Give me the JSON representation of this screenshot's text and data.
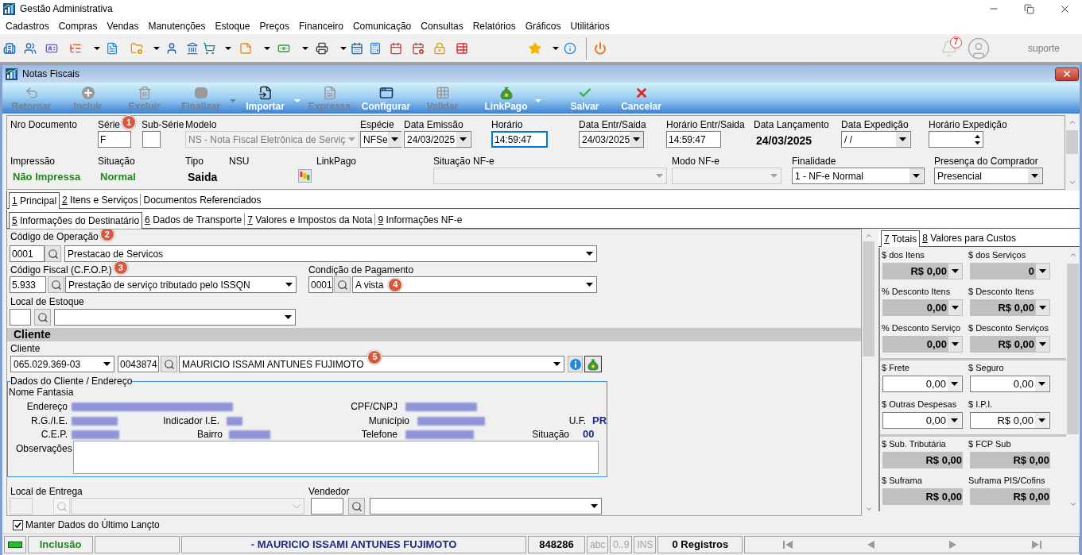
{
  "window": {
    "title": "Gestão Administrativa"
  },
  "menu": [
    "Cadastros",
    "Compras",
    "Vendas",
    "Manutenções",
    "Estoque",
    "Preços",
    "Financeiro",
    "Comunicação",
    "Consultas",
    "Relatórios",
    "Gráficos",
    "Utilitários"
  ],
  "toolbar": {
    "notification_count": "7",
    "user": "suporte"
  },
  "document_window": {
    "title": "Notas Fiscais"
  },
  "actions": [
    {
      "label": "Retornar",
      "disabled": true,
      "has_menu": false
    },
    {
      "label": "Incluir",
      "disabled": true,
      "has_menu": false
    },
    {
      "label": "Excluir",
      "disabled": true,
      "has_menu": false
    },
    {
      "label": "Finalizar",
      "disabled": true,
      "has_menu": true
    },
    {
      "label": "Importar",
      "disabled": false,
      "has_menu": true
    },
    {
      "label": "Expressa",
      "disabled": true,
      "has_menu": false
    },
    {
      "label": "Configurar",
      "disabled": false,
      "has_menu": false
    },
    {
      "label": "Validar",
      "disabled": true,
      "has_menu": false
    },
    {
      "label": "LinkPago",
      "disabled": false,
      "has_menu": true
    },
    {
      "label": "Salvar",
      "disabled": false,
      "has_menu": false
    },
    {
      "label": "Cancelar",
      "disabled": false,
      "has_menu": false
    }
  ],
  "header": {
    "fields": [
      {
        "label": "Nro Documento",
        "kind": "empty"
      },
      {
        "label": "Série",
        "kind": "input",
        "value": "F",
        "focused": false,
        "badge": "1"
      },
      {
        "label": "Sub-Série",
        "kind": "input",
        "focused": false
      },
      {
        "label": "Modelo",
        "kind": "select",
        "value": "NS - Nota Fiscal Eletrônica de Serviç",
        "disabled": true
      },
      {
        "label": "Espécie",
        "kind": "select",
        "value": "NFSe",
        "disabled": false
      },
      {
        "label": "Data Emissão",
        "kind": "select",
        "value": "24/03/2025",
        "disabled": false
      },
      {
        "label": "Horário",
        "kind": "input",
        "value": "14:59:47",
        "focused": true
      },
      {
        "label": "Data Entr/Saida",
        "kind": "select",
        "value": "24/03/2025",
        "disabled": false
      },
      {
        "label": "Horário Entr/Saida",
        "kind": "input",
        "value": "14:59:47",
        "focused": false
      },
      {
        "label": "Data Lançamento",
        "kind": "static",
        "value": "24/03/2025"
      },
      {
        "label": "Data Expedição",
        "kind": "select",
        "value": "/ /",
        "disabled": false
      },
      {
        "label": "Horário Expedição",
        "kind": "spinner"
      },
      {
        "label": "Impressão",
        "kind": "status",
        "value": "Não Impressa"
      },
      {
        "label": "Situação",
        "kind": "status",
        "value": "Normal"
      },
      {
        "label": "Tipo",
        "kind": "static",
        "value": "Saida"
      },
      {
        "label": "NSU",
        "kind": "empty"
      },
      {
        "label": "LinkPago",
        "kind": "icon_button"
      },
      {
        "label": "Situação NF-e",
        "kind": "select",
        "disabled": true
      },
      {
        "label": "Modo NF-e",
        "kind": "select",
        "disabled": true
      },
      {
        "label": "Finalidade",
        "kind": "select",
        "value": "1 - NF-e Normal",
        "disabled": false
      },
      {
        "label": "Presença do Comprador",
        "kind": "select",
        "value": "Presencial",
        "disabled": false
      }
    ]
  },
  "tabs": [
    {
      "key": "1",
      "label": "Principal",
      "selected": true
    },
    {
      "key": "2",
      "label": "Itens e Serviços",
      "selected": false
    },
    {
      "label": "Documentos Referenciados",
      "selected": false
    }
  ],
  "subtabs": [
    {
      "key": "5",
      "label": "Informações do Destinatário",
      "selected": true
    },
    {
      "key": "6",
      "label": "Dados de Transporte",
      "selected": false
    },
    {
      "key": "7",
      "label": "Valores e Impostos da Nota",
      "selected": false
    },
    {
      "key": "9",
      "label": "Informações NF-e",
      "selected": false
    }
  ],
  "destinatario": {
    "operation": {
      "label": "Código de Operação",
      "badge": "2",
      "code": "0001",
      "description": "Prestacao de Servicos"
    },
    "cfop": {
      "label": "Código Fiscal (C.F.O.P.)",
      "badge": "3",
      "code": "5.933",
      "description": "Prestação de serviço tributado pelo ISSQN"
    },
    "payment": {
      "label": "Condição de Pagamento",
      "badge": "4",
      "code": "0001",
      "description": "A vista"
    },
    "stock": {
      "label": "Local de Estoque"
    },
    "client": {
      "section_title": "Cliente",
      "label": "Cliente",
      "document": "065.029.369-03",
      "code": "0043874",
      "name": "MAURICIO ISSAMI ANTUNES FUJIMOTO",
      "badge": "5"
    },
    "details": {
      "legend": "Dados do Cliente / Endereço",
      "trade_name_label": "Nome Fantasia",
      "fields": [
        {
          "label": "Endereço",
          "redacted": true
        },
        {
          "label": "CPF/CNPJ",
          "redacted": true
        },
        {
          "label": "R.G./I.E.",
          "redacted": true
        },
        {
          "label": "Indicador I.E.",
          "redacted": true
        },
        {
          "label": "Município",
          "redacted": true
        },
        {
          "label": "U.F.",
          "redacted": false,
          "value": "PR"
        },
        {
          "label": "C.E.P.",
          "redacted": true
        },
        {
          "label": "Bairro",
          "redacted": true
        },
        {
          "label": "Telefone",
          "redacted": true
        },
        {
          "label": "Situação",
          "redacted": false,
          "value": "00"
        }
      ],
      "notes_label": "Observações"
    },
    "delivery": {
      "label": "Local de Entrega",
      "disabled": true
    },
    "seller": {
      "label": "Vendedor"
    }
  },
  "totals": {
    "tabs": [
      {
        "key": "7",
        "label": "Totais",
        "selected": true
      },
      {
        "key": "8",
        "label": "Valores para Custos",
        "selected": false
      }
    ],
    "groups": [
      {
        "rows": [
          [
            {
              "label": "$ dos Itens",
              "value": "R$ 0,00",
              "kind": "computed_menu"
            },
            {
              "label": "$ dos Serviços",
              "value": "0",
              "kind": "computed_menu"
            }
          ],
          [
            {
              "label": "% Desconto Itens",
              "value": "0,00",
              "kind": "computed_menu"
            },
            {
              "label": "$ Desconto Itens",
              "value": "R$ 0,00",
              "kind": "computed_menu"
            }
          ],
          [
            {
              "label": "% Desconto Serviço",
              "value": "0,00",
              "kind": "computed_menu"
            },
            {
              "label": "$ Desconto Serviços",
              "value": "R$ 0,00",
              "kind": "computed_menu"
            }
          ]
        ]
      },
      {
        "rows": [
          [
            {
              "label": "$ Frete",
              "value": "0,00",
              "kind": "input_menu"
            },
            {
              "label": "$ Seguro",
              "value": "0,00",
              "kind": "input_menu"
            }
          ],
          [
            {
              "label": "$ Outras Despesas",
              "value": "0,00",
              "kind": "input_menu"
            },
            {
              "label": "$ I.P.I.",
              "value": "R$ 0,00",
              "kind": "input_menu"
            }
          ]
        ]
      },
      {
        "rows": [
          [
            {
              "label": "$ Sub. Tributária",
              "value": "R$ 0,00",
              "kind": "computed"
            },
            {
              "label": "$ FCP Sub",
              "value": "R$ 0,00",
              "kind": "computed"
            }
          ],
          [
            {
              "label": "$ Suframa",
              "value": "R$ 0,00",
              "kind": "computed"
            },
            {
              "label": "Suframa PIS/Cofins",
              "value": "R$ 0,00",
              "kind": "computed"
            }
          ]
        ]
      }
    ]
  },
  "keep_data": {
    "label": "Manter Dados do Último Lançto",
    "checked": true
  },
  "status_bar": {
    "mode": "Inclusão",
    "client": "- MAURICIO ISSAMI ANTUNES FUJIMOTO",
    "number": "848286",
    "indicators": [
      {
        "label": "abc",
        "active": false
      },
      {
        "label": "0..9",
        "active": false
      },
      {
        "label": "INS",
        "active": false
      }
    ],
    "records": "0 Registros"
  }
}
